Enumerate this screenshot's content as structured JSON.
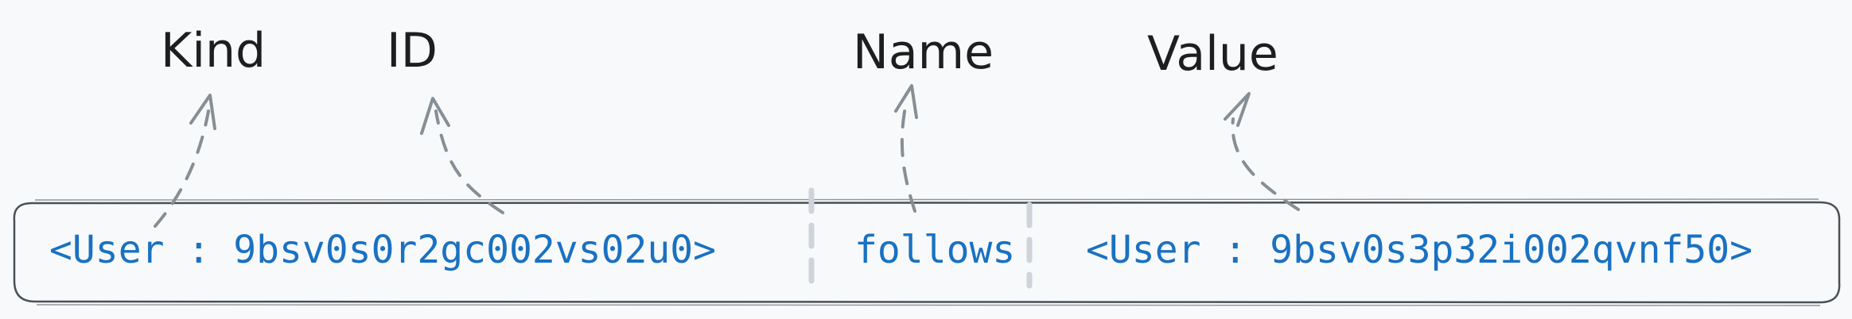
{
  "labels": {
    "kind": "Kind",
    "id": "ID",
    "name": "Name",
    "value": "Value"
  },
  "record": {
    "source": "<User : 9bsv0s0r2gc002vs02u0>",
    "relation": "follows",
    "target": "<User : 9bsv0s3p32i002qvnf50>"
  },
  "colors": {
    "label_text": "#1e1e1e",
    "record_text": "#1971c2",
    "arrows": "#868e96",
    "box_stroke": "#495057",
    "dividers": "#ced4da",
    "background": "#f8f9fa"
  }
}
